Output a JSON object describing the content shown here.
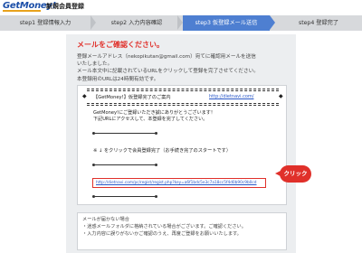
{
  "header": {
    "logo": "GetMoney!",
    "title": "新規会員登録"
  },
  "steps": [
    {
      "label": "step1  登録情報入力",
      "active": false
    },
    {
      "label": "step2  入力内容確認",
      "active": false
    },
    {
      "label": "step3  仮登録メール送信",
      "active": true
    },
    {
      "label": "step4  登録完了",
      "active": false
    }
  ],
  "main": {
    "title": "メールをご確認ください。",
    "desc": [
      "登録メールアドレス（nekopikutan@gmail.com）宛てに確認用メールを送信",
      "いたしました。",
      "メール本文中に記載されているURLをクリックして登録を完了させてください。",
      "本登録用のURLは24時間有効です。"
    ]
  },
  "email": {
    "subject": "【GetMoney!】仮登録完了のご案内",
    "site_link": "http://dietnavi.com/",
    "body": [
      "GetMoney!にご登録いただき誠にありがとうございます！",
      "下記URLにアクセスして、本登録を完了してください。"
    ],
    "notice": "※ ↓ をクリックで会員登録完了（お手続き完了のスタートです）",
    "register_url": "http://dietnavi.com/pc/regist/regist.php?key=a6f1bdc5e3c7a18cc5f4d0b90c9b0cd"
  },
  "click_label": "クリック",
  "help": {
    "title": "メールが届かない場合",
    "items": [
      "・迷惑メールフォルダに格納されている場合がございます。ご確認ください。",
      "・入力内容に誤りがないかご確認のうえ、再度ご登録をお願いいたします。"
    ]
  },
  "colors": {
    "accent_blue": "#4e7fd1",
    "alert_red": "#e0302a",
    "logo_blue": "#1c4fa8"
  }
}
